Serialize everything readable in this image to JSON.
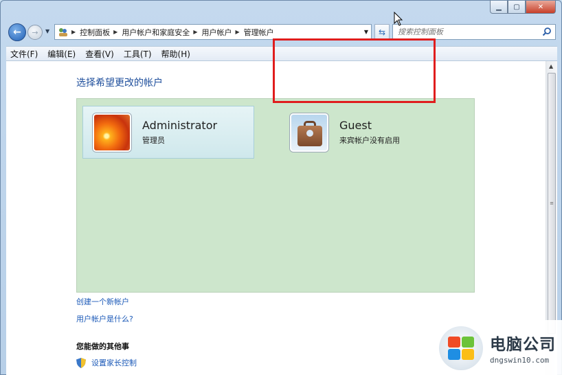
{
  "window": {
    "caption": {
      "minimize": "▁",
      "maximize": "▢",
      "close": "✕"
    }
  },
  "nav": {
    "breadcrumbs": [
      "控制面板",
      "用户帐户和家庭安全",
      "用户帐户",
      "管理帐户"
    ],
    "search_placeholder": "搜索控制面板"
  },
  "menu": {
    "items": [
      "文件(F)",
      "编辑(E)",
      "查看(V)",
      "工具(T)",
      "帮助(H)"
    ]
  },
  "main": {
    "title": "选择希望更改的帐户",
    "accounts": [
      {
        "name": "Administrator",
        "subtitle": "管理员",
        "icon": "flower-avatar-icon"
      },
      {
        "name": "Guest",
        "subtitle": "来宾帐户没有启用",
        "icon": "briefcase-avatar-icon"
      }
    ],
    "links": [
      "创建一个新帐户",
      "用户帐户是什么?"
    ],
    "other_heading": "您能做的其他事",
    "parental_control": "设置家长控制"
  },
  "watermark": {
    "title": "电脑公司",
    "url": "dngswin10.com"
  },
  "colors": {
    "accent_link": "#1c5ab8",
    "title_blue": "#1f4f9c",
    "account_panel": "#cde6cc",
    "highlight_red": "#e01d1d"
  }
}
